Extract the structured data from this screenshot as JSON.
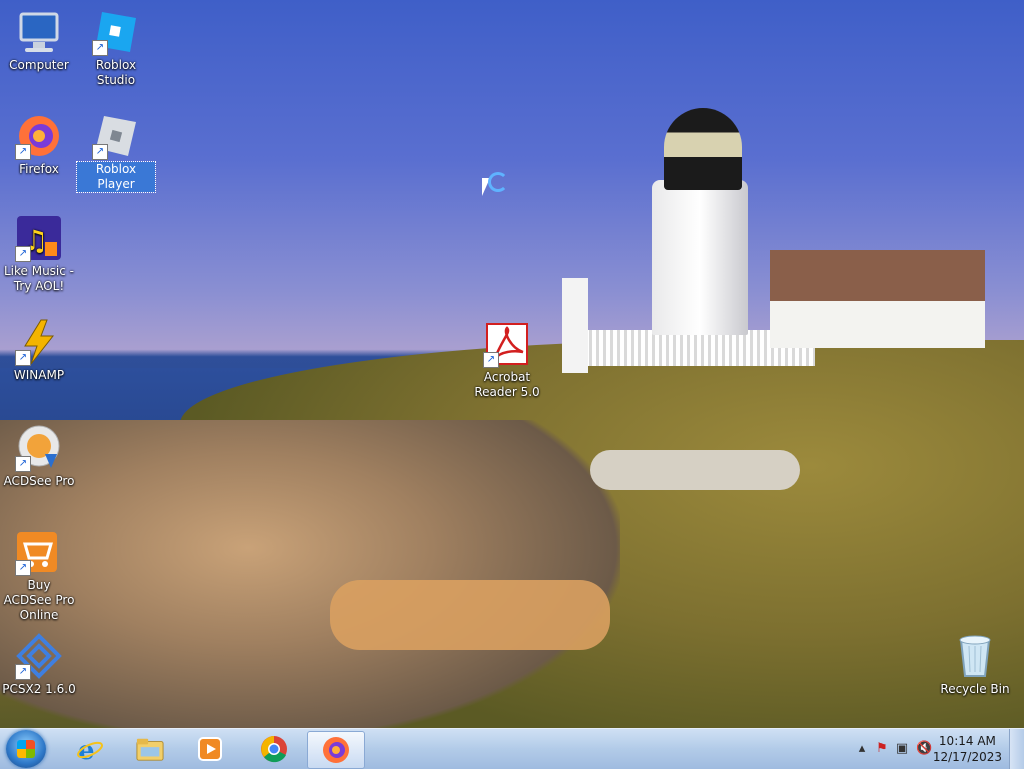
{
  "desktop": {
    "icons": [
      {
        "label": "Computer"
      },
      {
        "label": "Roblox Studio"
      },
      {
        "label": "Firefox"
      },
      {
        "label": "Roblox Player"
      },
      {
        "label": "Like Music - Try AOL!"
      },
      {
        "label": "WINAMP"
      },
      {
        "label": "ACDSee Pro"
      },
      {
        "label": "Buy ACDSee Pro Online"
      },
      {
        "label": "PCSX2 1.6.0"
      },
      {
        "label": "Acrobat Reader 5.0"
      },
      {
        "label": "Recycle Bin"
      }
    ]
  },
  "taskbar": {
    "pinned": [
      {
        "name": "Internet Explorer"
      },
      {
        "name": "Windows Explorer"
      },
      {
        "name": "Windows Media Player"
      },
      {
        "name": "Google Chrome"
      },
      {
        "name": "Firefox"
      }
    ],
    "clock": {
      "time": "10:14 AM",
      "date": "12/17/2023"
    }
  },
  "colors": {
    "taskbar": "#b2cbe8",
    "selection": "#3a78d6"
  }
}
